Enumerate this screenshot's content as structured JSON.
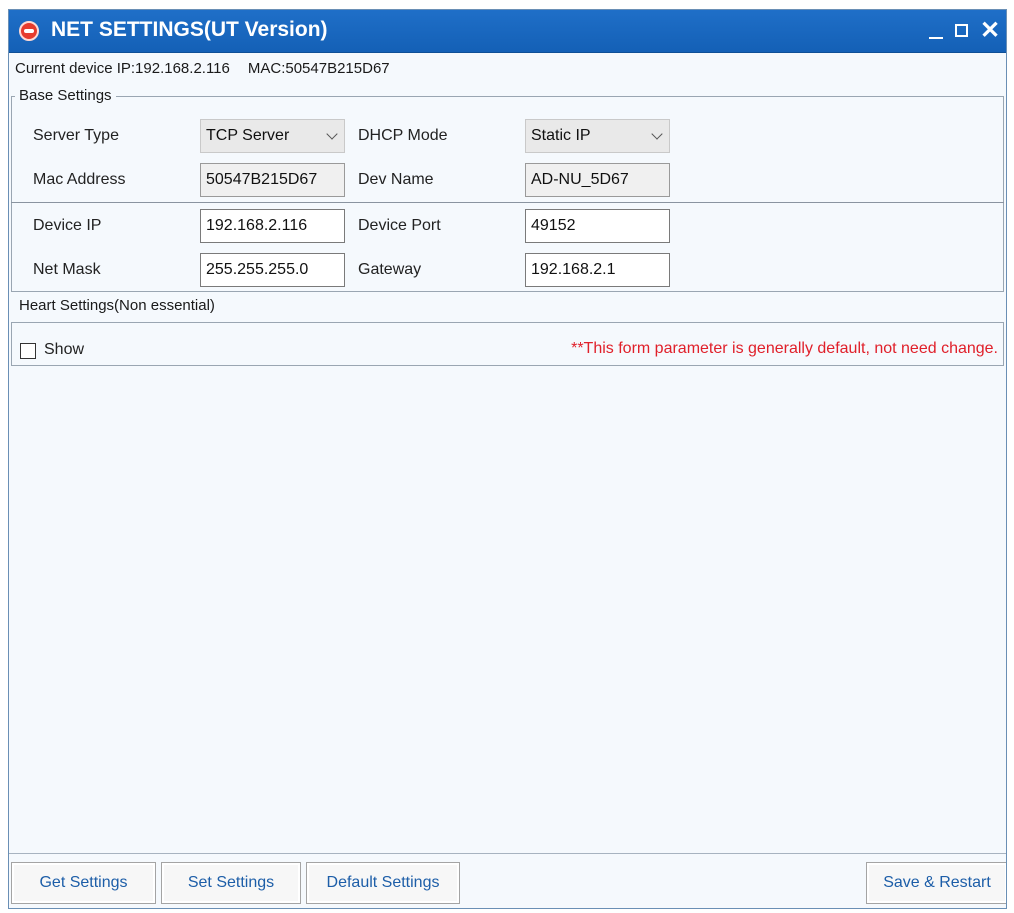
{
  "window": {
    "title": "NET SETTINGS(UT Version)",
    "controls": [
      "minimize",
      "maximize",
      "close"
    ],
    "close_glyph": "✕"
  },
  "current_device": {
    "ip_text": "Current device IP:192.168.2.116",
    "mac_text": "MAC:50547B215D67"
  },
  "base_settings": {
    "group_label": "Base Settings",
    "server_type": {
      "label": "Server Type",
      "value": "TCP Server"
    },
    "dhcp_mode": {
      "label": "DHCP Mode",
      "value": "Static IP"
    },
    "mac_address": {
      "label": "Mac Address",
      "value": "50547B215D67"
    },
    "dev_name": {
      "label": "Dev Name",
      "value": "AD-NU_5D67"
    },
    "device_ip": {
      "label": "Device IP",
      "value": "192.168.2.116"
    },
    "device_port": {
      "label": "Device Port",
      "value": "49152"
    },
    "net_mask": {
      "label": "Net Mask",
      "value": "255.255.255.0"
    },
    "gateway": {
      "label": "Gateway",
      "value": "192.168.2.1"
    }
  },
  "heart_settings": {
    "group_label": "Heart Settings(Non essential)",
    "show_label": "Show",
    "show_checked": false,
    "note": "**This form parameter is generally default, not need change."
  },
  "buttons": {
    "get": "Get Settings",
    "set": "Set Settings",
    "default": "Default Settings",
    "save_restart": "Save & Restart"
  },
  "colors": {
    "titlebar": "#1460b6",
    "note_red": "#e0202a",
    "button_text": "#1d5ea8"
  },
  "icons": {
    "app_logo": "rfid-logo-icon",
    "select_arrow": "chevron-down-icon"
  }
}
